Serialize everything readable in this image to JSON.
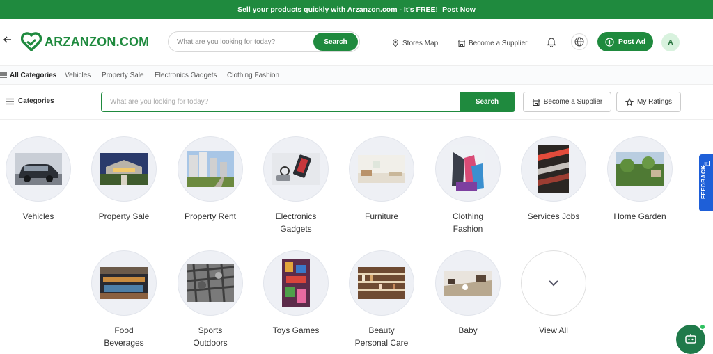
{
  "banner": {
    "text": "Sell your products quickly with Arzanzon.com - It's FREE!",
    "link": "Post Now"
  },
  "header": {
    "logo_text": "ARZANZON.COM",
    "search_placeholder": "What are you looking for today?",
    "search_button": "Search",
    "stores_map": "Stores Map",
    "become_supplier": "Become a Supplier",
    "post_ad": "Post Ad",
    "avatar_initial": "A"
  },
  "catnav": {
    "all_label": "All Categories",
    "items": [
      "Vehicles",
      "Property Sale",
      "Electronics Gadgets",
      "Clothing Fashion"
    ]
  },
  "bar2": {
    "categories_label": "Categories",
    "search_placeholder": "What are you looking for today?",
    "search_button": "Search",
    "become_supplier": "Become a Supplier",
    "my_ratings": "My Ratings"
  },
  "categories": [
    {
      "label": "Vehicles",
      "icon": "car-image"
    },
    {
      "label": "Property Sale",
      "icon": "house-image"
    },
    {
      "label": "Property Rent",
      "icon": "buildings-image"
    },
    {
      "label": "Electronics Gadgets",
      "icon": "gadgets-image"
    },
    {
      "label": "Furniture",
      "icon": "furniture-image"
    },
    {
      "label": "Clothing Fashion",
      "icon": "clothing-image"
    },
    {
      "label": "Services Jobs",
      "icon": "services-image"
    },
    {
      "label": "Home Garden",
      "icon": "garden-image"
    },
    {
      "label": "Food Beverages",
      "icon": "food-image"
    },
    {
      "label": "Sports Outdoors",
      "icon": "sports-image"
    },
    {
      "label": "Toys Games",
      "icon": "toys-image"
    },
    {
      "label": "Beauty Personal Care",
      "icon": "beauty-image"
    },
    {
      "label": "Baby",
      "icon": "baby-image"
    }
  ],
  "view_all": "View All",
  "feedback": "FEEDBACK",
  "colors": {
    "brand": "#1f8a3e",
    "feedback": "#1e5fd8"
  }
}
